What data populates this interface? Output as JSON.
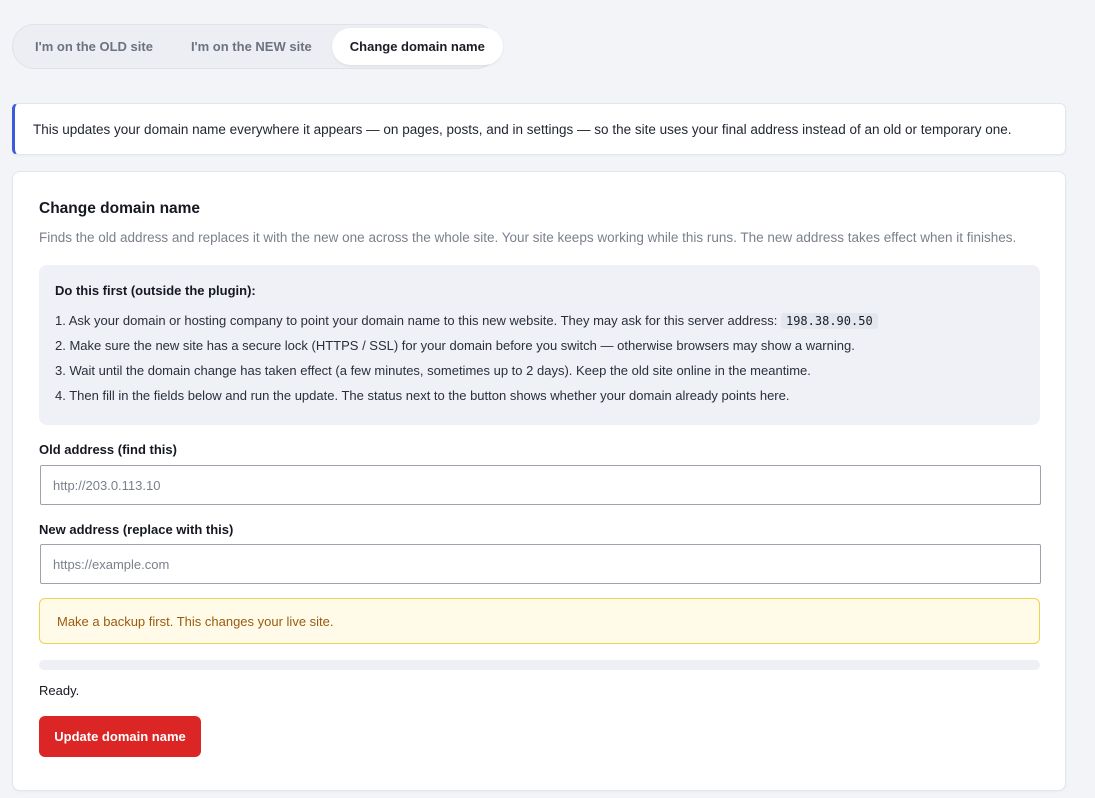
{
  "tabs": [
    {
      "label": "I'm on the OLD site",
      "active": false
    },
    {
      "label": "I'm on the NEW site",
      "active": false
    },
    {
      "label": "Change domain name",
      "active": true
    }
  ],
  "info_banner": {
    "text": "This updates your domain name everywhere it appears — on pages, posts, and in settings — so the site uses your final address instead of an old or temporary one."
  },
  "card": {
    "title": "Change domain name",
    "subtitle": "Finds the old address and replaces it with the new one across the whole site. Your site keeps working while this runs. The new address takes effect when it finishes.",
    "prereq": {
      "title": "Do this first (outside the plugin):",
      "steps": [
        {
          "text": "1. Ask your domain or hosting company to point your domain name to this new website. They may ask for this server address:",
          "code": "198.38.90.50"
        },
        {
          "text": "2. Make sure the new site has a secure lock (HTTPS / SSL) for your domain before you switch — otherwise browsers may show a warning."
        },
        {
          "text": "3. Wait until the domain change has taken effect (a few minutes, sometimes up to 2 days). Keep the old site online in the meantime."
        },
        {
          "text": "4. Then fill in the fields below and run the update. The status next to the button shows whether your domain already points here."
        }
      ]
    },
    "old_field": {
      "label": "Old address (find this)",
      "value": "",
      "placeholder": "http://203.0.113.10"
    },
    "new_field": {
      "label": "New address (replace with this)",
      "value": "",
      "placeholder": "https://example.com"
    },
    "warning": "Make a backup first. This changes your live site.",
    "progress": 0,
    "status": "Ready.",
    "button_label": "Update domain name"
  },
  "colors": {
    "accent": "#3b5bdb",
    "danger": "#dc2626",
    "warning_bg": "#fffbe8",
    "warning_border": "#f0d24b",
    "warning_text": "#9a5b0f"
  }
}
